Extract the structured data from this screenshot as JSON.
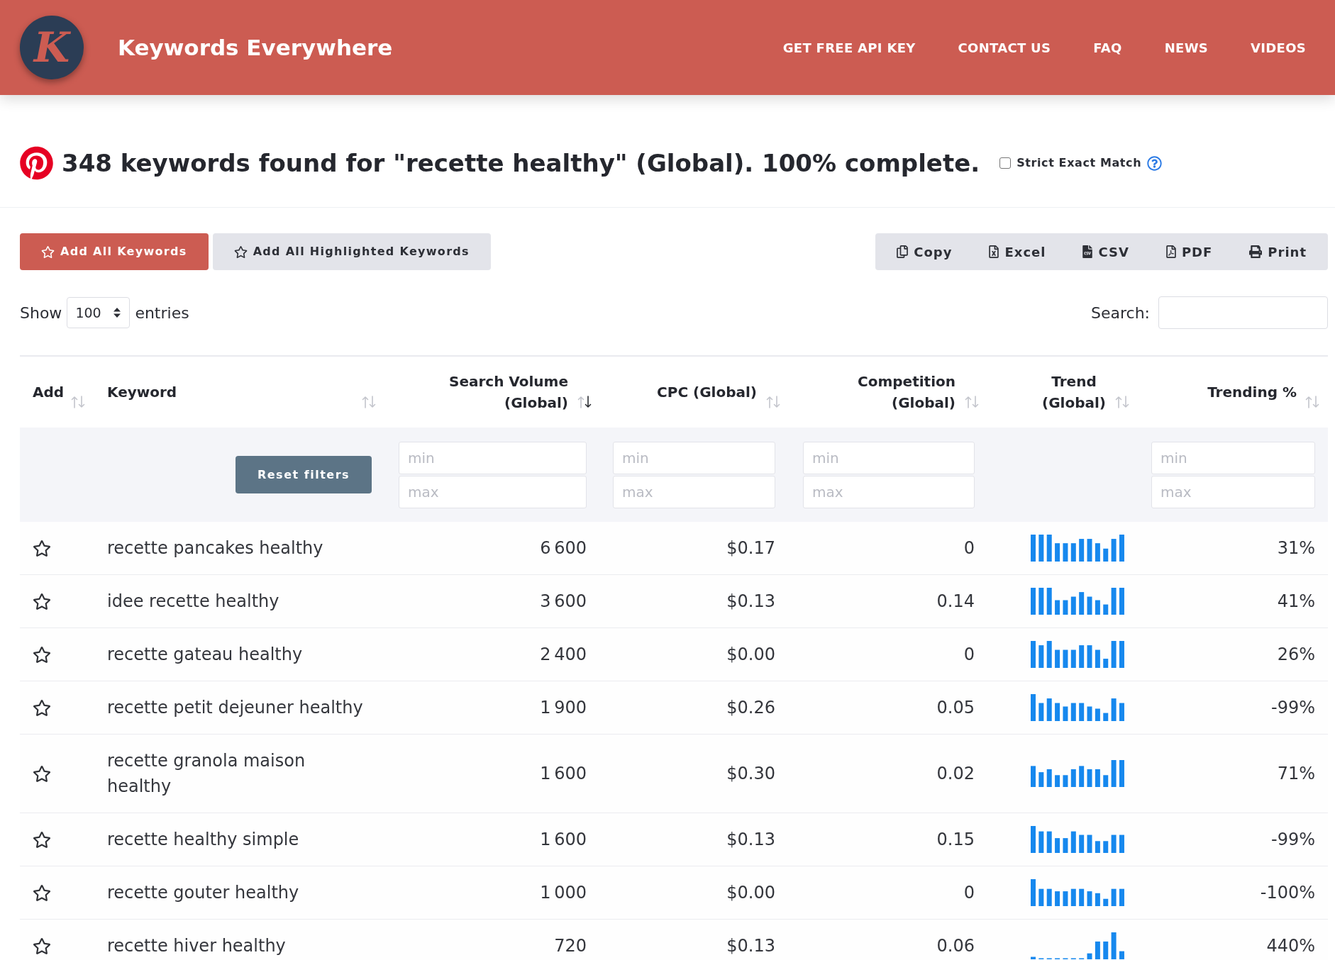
{
  "header": {
    "logo_letter": "K",
    "title": "Keywords Everywhere",
    "nav": [
      "GET FREE API KEY",
      "CONTACT US",
      "FAQ",
      "NEWS",
      "VIDEOS"
    ]
  },
  "summary": {
    "title": "348 keywords found for \"recette healthy\" (Global). 100% complete.",
    "strict_exact_match": {
      "label": "Strict Exact Match",
      "checked": false
    }
  },
  "actions": [
    {
      "label": "Add All Keywords",
      "kind": "primary"
    },
    {
      "label": "Add All Highlighted Keywords",
      "kind": "secondary"
    }
  ],
  "export_buttons": [
    {
      "label": "Copy",
      "kind": "copy"
    },
    {
      "label": "Excel",
      "kind": "excel"
    },
    {
      "label": "CSV",
      "kind": "csv"
    },
    {
      "label": "PDF",
      "kind": "pdf"
    },
    {
      "label": "Print",
      "kind": "print"
    }
  ],
  "length_control": {
    "prefix": "Show",
    "value": "100",
    "suffix": "entries"
  },
  "search": {
    "label": "Search:"
  },
  "table": {
    "columns": [
      {
        "label": "Add",
        "sorted_ascending": false,
        "sorted_descending": false
      },
      {
        "label": "Keyword",
        "sorted_ascending": false,
        "sorted_descending": false
      },
      {
        "label": "Search Volume (Global)",
        "sorted_ascending": false,
        "sorted_descending": true,
        "filter": {
          "min_placeholder": "min",
          "max_placeholder": "max"
        }
      },
      {
        "label": "CPC (Global)",
        "sorted_ascending": false,
        "sorted_descending": false,
        "filter": {
          "min_placeholder": "min",
          "max_placeholder": "max"
        }
      },
      {
        "label": "Competition (Global)",
        "sorted_ascending": false,
        "sorted_descending": false,
        "filter": {
          "min_placeholder": "min",
          "max_placeholder": "max"
        }
      },
      {
        "label": "Trend (Global)",
        "sorted_ascending": false,
        "sorted_descending": false
      },
      {
        "label": "Trending %",
        "sorted_ascending": false,
        "sorted_descending": false,
        "filter": {
          "min_placeholder": "min",
          "max_placeholder": "max"
        }
      }
    ],
    "reset_filters": "Reset filters",
    "rows": [
      {
        "added": false,
        "keyword": "recette pancakes healthy",
        "search_volume": "6 600",
        "cpc": "$0.17",
        "competition": "0",
        "trending": "31%"
      },
      {
        "added": false,
        "keyword": "idee recette healthy",
        "search_volume": "3 600",
        "cpc": "$0.13",
        "competition": "0.14",
        "trending": "41%"
      },
      {
        "added": false,
        "keyword": "recette gateau healthy",
        "search_volume": "2 400",
        "cpc": "$0.00",
        "competition": "0",
        "trending": "26%"
      },
      {
        "added": false,
        "keyword": "recette petit dejeuner healthy",
        "search_volume": "1 900",
        "cpc": "$0.26",
        "competition": "0.05",
        "trending": "-99%"
      },
      {
        "added": false,
        "keyword": "recette granola maison healthy",
        "search_volume": "1 600",
        "cpc": "$0.30",
        "competition": "0.02",
        "trending": "71%"
      },
      {
        "added": false,
        "keyword": "recette healthy simple",
        "search_volume": "1 600",
        "cpc": "$0.13",
        "competition": "0.15",
        "trending": "-99%"
      },
      {
        "added": false,
        "keyword": "recette gouter healthy",
        "search_volume": "1 000",
        "cpc": "$0.00",
        "competition": "0",
        "trending": "-100%"
      },
      {
        "added": false,
        "keyword": "recette hiver healthy",
        "search_volume": "720",
        "cpc": "$0.13",
        "competition": "0.06",
        "trending": "440%"
      }
    ]
  }
}
